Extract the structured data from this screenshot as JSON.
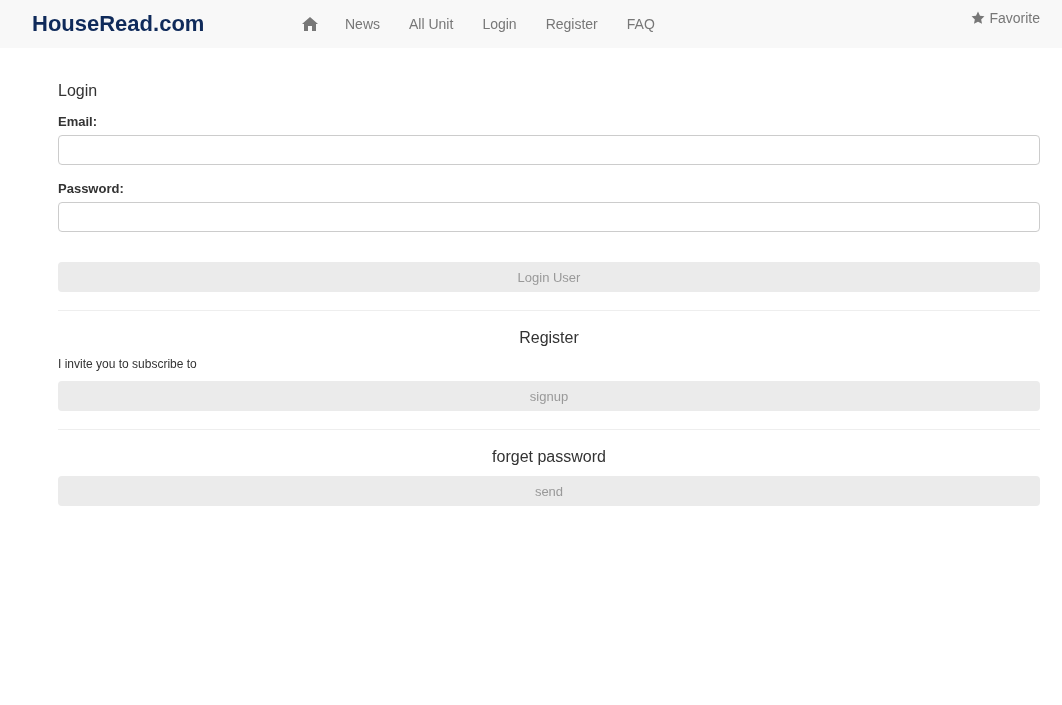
{
  "navbar": {
    "brand": "HouseRead.com",
    "links": [
      "News",
      "All Unit",
      "Login",
      "Register",
      "FAQ"
    ],
    "favorite": "Favorite"
  },
  "login": {
    "title": "Login",
    "fields": [
      {
        "label": "Email:"
      },
      {
        "label": "Password:"
      }
    ],
    "button": {
      "label": "Login User",
      "disabled": true
    }
  },
  "register": {
    "title": "Register",
    "text": "I invite you to subscribe to",
    "button": {
      "label": "signup",
      "disabled": true
    }
  },
  "forget": {
    "title": "forget password",
    "button": {
      "label": "send",
      "disabled": true
    }
  }
}
